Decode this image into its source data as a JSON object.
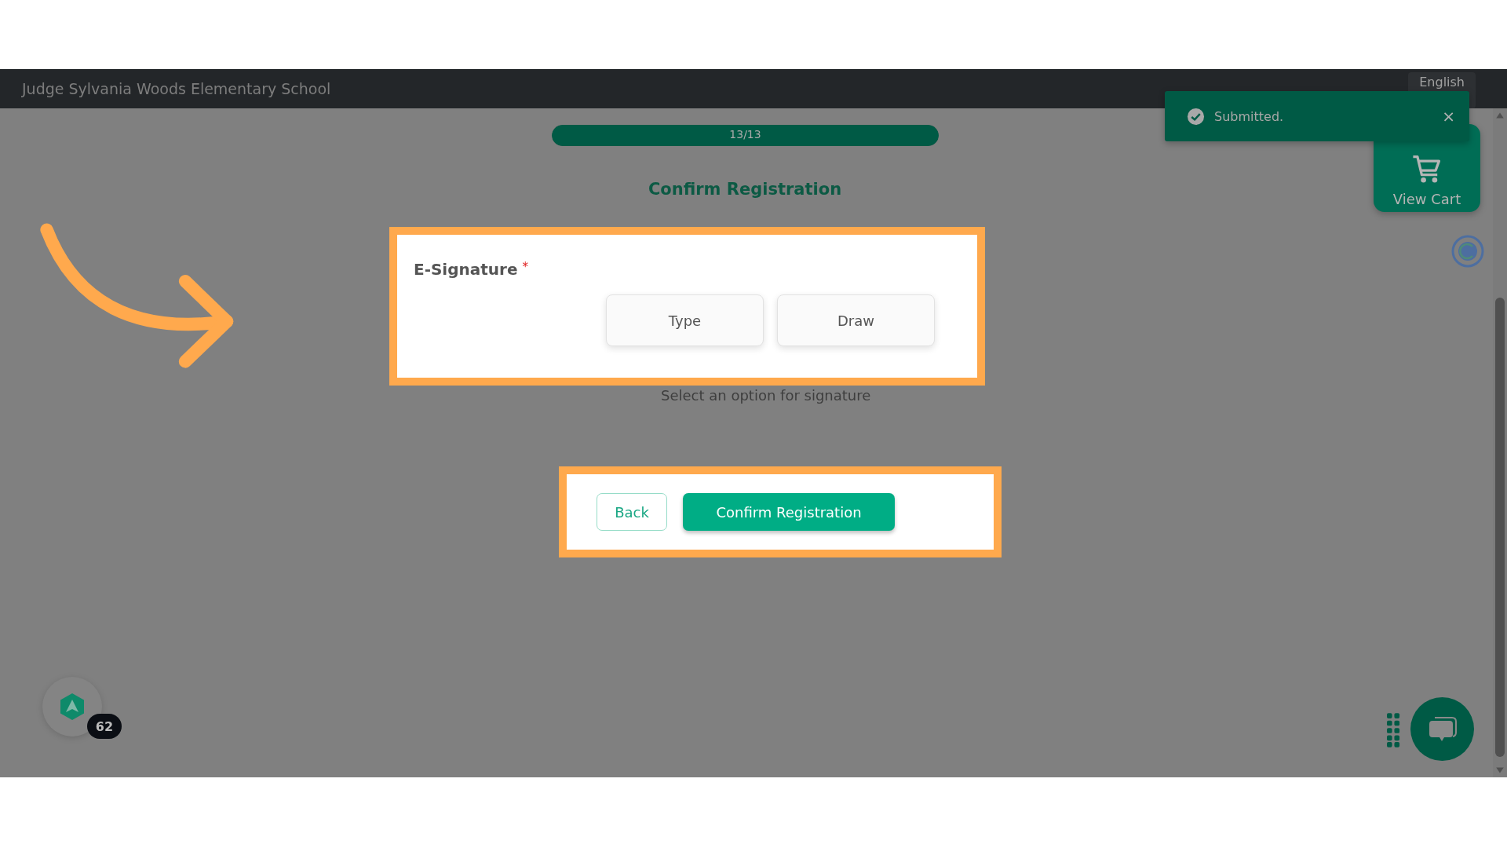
{
  "header": {
    "school_name": "Judge Sylvania Woods Elementary School",
    "language": "English"
  },
  "progress": {
    "label": "13/13",
    "level": 1
  },
  "page_title": "Confirm Registration",
  "signature": {
    "label": "E-Signature",
    "required_mark": "*",
    "options": [
      {
        "label": "Type",
        "selected": false
      },
      {
        "label": "Draw",
        "selected": false
      }
    ],
    "hint": "Select an option for signature"
  },
  "actions": [
    {
      "label": "Back",
      "kind": "secondary"
    },
    {
      "label": "Confirm Registration",
      "kind": "primary"
    }
  ],
  "toast": {
    "message": "Submitted.",
    "close": "×"
  },
  "cart": {
    "label": "View Cart"
  },
  "badge": {
    "count": "62"
  }
}
